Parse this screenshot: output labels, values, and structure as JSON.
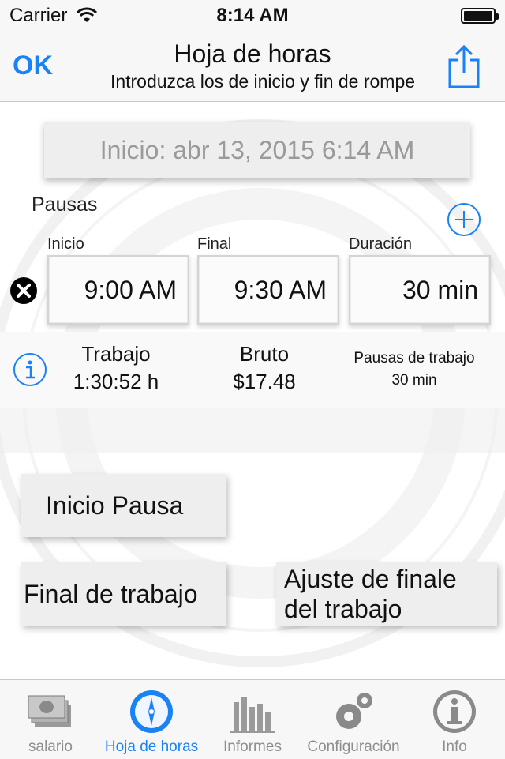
{
  "status_bar": {
    "carrier": "Carrier",
    "time": "8:14 AM"
  },
  "nav": {
    "ok_label": "OK",
    "title": "Hoja de horas",
    "subtitle": "Introduzca los de inicio y fin de rompe"
  },
  "start": {
    "label": "Inicio: abr 13, 2015 6:14 AM"
  },
  "pauses": {
    "section_label": "Pausas",
    "columns": [
      "Inicio",
      "Final",
      "Duración"
    ],
    "rows": [
      {
        "start": "9:00 AM",
        "end": "9:30 AM",
        "duration": "30 min"
      }
    ]
  },
  "summary": {
    "work_label": "Trabajo",
    "work_value": "1:30:52 h",
    "gross_label": "Bruto",
    "gross_value": "$17.48",
    "breaks_label": "Pausas de trabajo",
    "breaks_value": "30 min"
  },
  "actions": {
    "start_pause": "Inicio Pausa",
    "end_work": "Final de trabajo",
    "adjust_end_line1": "Ajuste de finale",
    "adjust_end_line2": "del trabajo"
  },
  "tabs": [
    {
      "label": "salario",
      "icon": "money-icon",
      "active": false
    },
    {
      "label": "Hoja de horas",
      "icon": "compass-icon",
      "active": true
    },
    {
      "label": "Informes",
      "icon": "bar-chart-icon",
      "active": false
    },
    {
      "label": "Configuración",
      "icon": "gears-icon",
      "active": false
    },
    {
      "label": "Info",
      "icon": "info-icon",
      "active": false
    }
  ],
  "colors": {
    "accent": "#1a82f5",
    "inactive": "#8e8e8e"
  }
}
